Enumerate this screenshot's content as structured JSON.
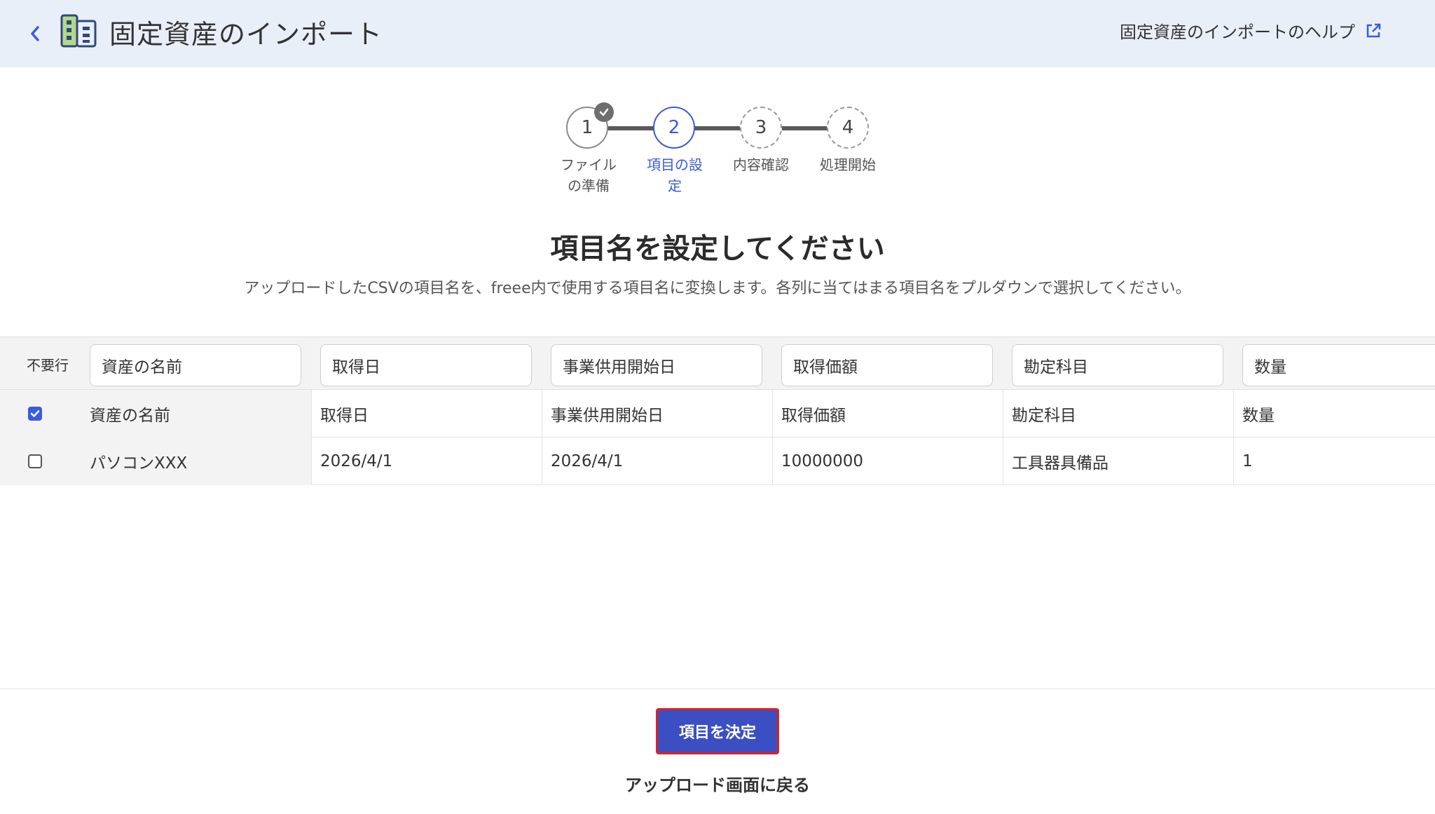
{
  "header": {
    "back_icon": "chevron-left-icon",
    "app_icon": "fixed-asset-icon",
    "title": "固定資産のインポート",
    "help_link": "固定資産のインポートのヘルプ",
    "help_icon": "external-link-icon"
  },
  "stepper": {
    "steps": [
      {
        "number": "1",
        "label_line1": "ファイル",
        "label_line2": "の準備",
        "state": "done"
      },
      {
        "number": "2",
        "label_line1": "項目の設",
        "label_line2": "定",
        "state": "active"
      },
      {
        "number": "3",
        "label_line1": "内容確認",
        "label_line2": "",
        "state": "todo"
      },
      {
        "number": "4",
        "label_line1": "処理開始",
        "label_line2": "",
        "state": "todo"
      }
    ]
  },
  "main": {
    "heading": "項目名を設定してください",
    "description": "アップロードしたCSVの項目名を、freee内で使用する項目名に変換します。各列に当てはまる項目名をプルダウンで選択してください。"
  },
  "table": {
    "unneeded_label": "不要行",
    "column_selects": [
      "資産の名前",
      "取得日",
      "事業供用開始日",
      "取得価額",
      "勘定科目",
      "数量"
    ],
    "rows": [
      {
        "checked": true,
        "cells": [
          "資産の名前",
          "取得日",
          "事業供用開始日",
          "取得価額",
          "勘定科目",
          "数量"
        ]
      },
      {
        "checked": false,
        "cells": [
          "パソコンXXX",
          "2026/4/1",
          "2026/4/1",
          "10000000",
          "工具器具備品",
          "1"
        ]
      }
    ]
  },
  "footer": {
    "confirm_button": "項目を決定",
    "back_link": "アップロード画面に戻る"
  },
  "colors": {
    "accent": "#3b5bdb",
    "header_bg": "#e9eff9",
    "button_bg": "#3b4fc2",
    "highlight_border": "#e02020"
  }
}
